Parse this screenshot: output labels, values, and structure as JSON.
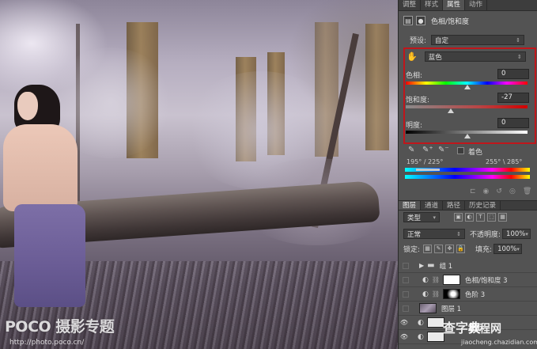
{
  "watermark": {
    "logo": "POCO 摄影专题",
    "url": "http://photo.poco.cn/"
  },
  "site_watermark": {
    "badge": "查字典",
    "name": "教程网",
    "url": "jiaocheng.chazidian.com"
  },
  "panel_tabs": [
    "调整",
    "样式",
    "属性",
    "动作"
  ],
  "properties": {
    "title": "色相/饱和度",
    "preset_label": "预设:",
    "preset_value": "自定",
    "channel_value": "蓝色",
    "hue_label": "色相:",
    "hue_value": "0",
    "saturation_label": "饱和度:",
    "saturation_value": "-27",
    "lightness_label": "明度:",
    "lightness_value": "0",
    "colorize_label": "着色",
    "range_left": "195° / 225°",
    "range_right": "255° \\ 285°"
  },
  "layers_tabs": [
    "图层",
    "通道",
    "路径",
    "历史记录"
  ],
  "layers": {
    "kind_label": "类型",
    "blend_mode": "正常",
    "opacity_label": "不透明度:",
    "opacity_value": "100%",
    "lock_label": "锁定:",
    "fill_label": "填充:",
    "fill_value": "100%",
    "items": [
      {
        "name": "组 1",
        "visible": false
      },
      {
        "name": "色相/饱和度 3",
        "visible": false
      },
      {
        "name": "色阶 3",
        "visible": false
      },
      {
        "name": "图层 1",
        "visible": false
      },
      {
        "name": "",
        "visible": true
      },
      {
        "name": "",
        "visible": true
      }
    ]
  },
  "colors": {
    "highlight": "#c0161b",
    "panel_bg": "#535353",
    "tab_bg": "#3d3d3d"
  }
}
